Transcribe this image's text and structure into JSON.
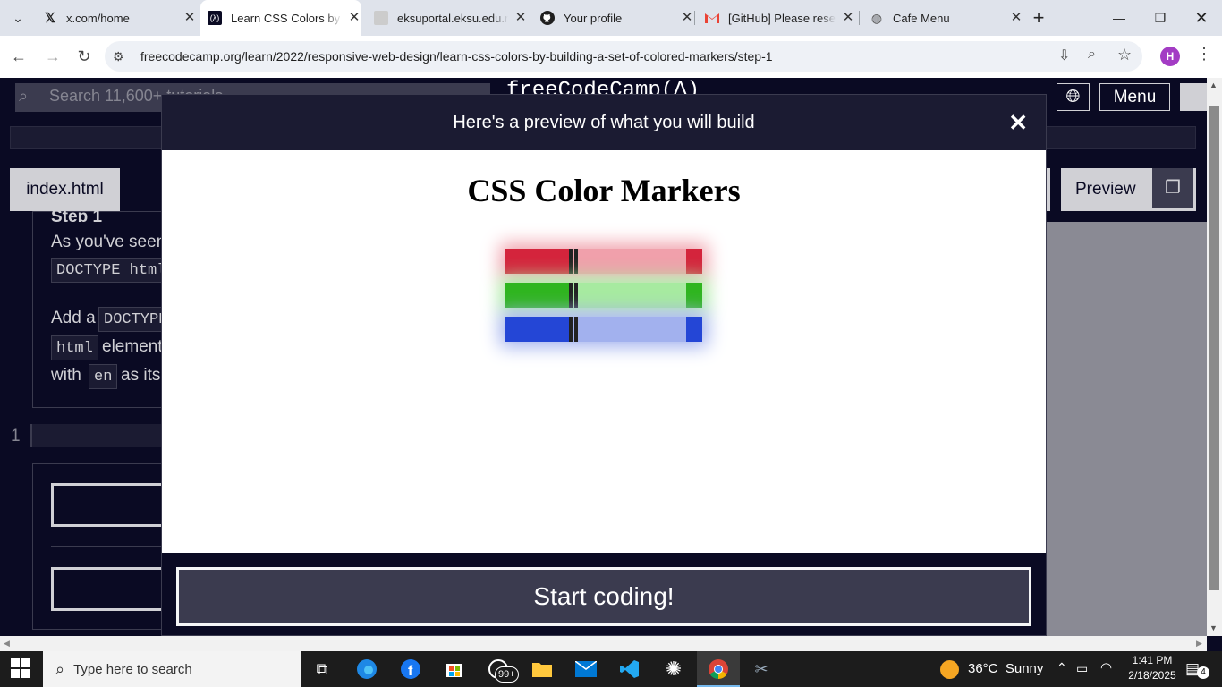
{
  "browser": {
    "tabs": [
      {
        "title": "x.com/home",
        "icon": "x-logo-icon"
      },
      {
        "title": "Learn CSS Colors by Building a Set of Colored Markers",
        "icon": "freecodecamp-icon",
        "active": true
      },
      {
        "title": "eksuportal.eksu.edu.ng",
        "icon": "portal-icon"
      },
      {
        "title": "Your profile",
        "icon": "github-icon"
      },
      {
        "title": "[GitHub] Please reset your password",
        "icon": "gmail-icon"
      },
      {
        "title": "Cafe Menu",
        "icon": "globe-icon"
      }
    ],
    "new_tab": "+",
    "url": "freecodecamp.org/learn/2022/responsive-web-design/learn-css-colors-by-building-a-set-of-colored-markers/step-1",
    "profile_initial": "H"
  },
  "fcc": {
    "search_placeholder": "Search 11,600+ tutorials",
    "logo": "freeCodeCamp(Δ)",
    "menu": "Menu",
    "file_tab": "index.html",
    "preview_tab": "Preview",
    "step_heading": "Step 1",
    "instructions": {
      "l1": "As you've seen",
      "l1_code": "DOCTYPE html",
      "l2": "Add a",
      "l2_code": "DOCTYPE",
      "l3_code": "html",
      "l3": "element",
      "l4": "with",
      "l4_code": "en",
      "l4b": "as its"
    },
    "line_number": "1"
  },
  "modal": {
    "title": "Here's a preview of what you will build",
    "close": "✕",
    "preview_heading": "CSS Color Markers",
    "markers": [
      {
        "color": "red",
        "cap": "#d4243c",
        "sleeve": "#f0a0ab"
      },
      {
        "color": "green",
        "cap": "#2fb51f",
        "sleeve": "#a7eaa0"
      },
      {
        "color": "blue",
        "cap": "#2446d6",
        "sleeve": "#a2b1ee"
      }
    ],
    "start_button": "Start coding!"
  },
  "taskbar": {
    "search_placeholder": "Type here to search",
    "whatsapp_badge": "99+",
    "weather": "36°C  Sunny",
    "time": "1:41 PM",
    "date": "2/18/2025",
    "notifications": "4"
  }
}
